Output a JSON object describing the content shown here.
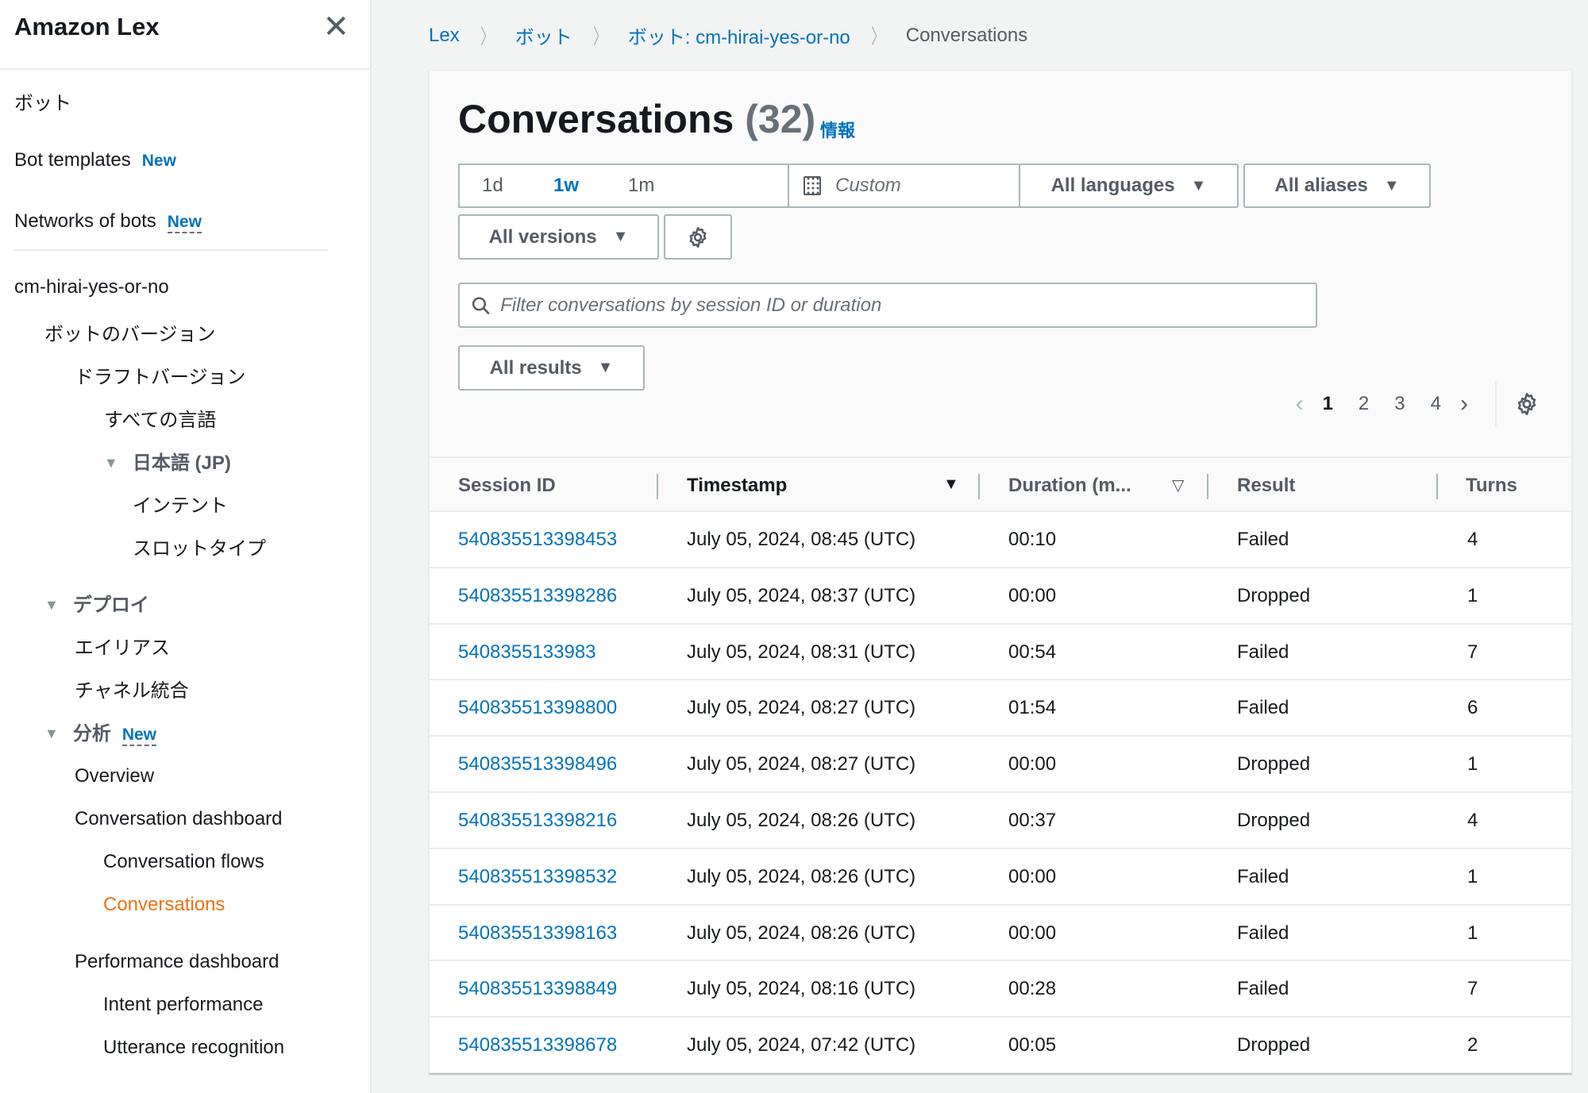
{
  "sidebar": {
    "title": "Amazon Lex",
    "close_label": "✕",
    "items": {
      "bots": "ボット",
      "bot_templates": "Bot templates",
      "bot_templates_badge": "New",
      "networks_of_bots": "Networks of bots",
      "networks_badge": "New",
      "bot_name": "cm-hirai-yes-or-no",
      "bot_versions": "ボットのバージョン",
      "draft_version": "ドラフトバージョン",
      "all_languages": "すべての言語",
      "japanese": "日本語 (JP)",
      "intents": "インテント",
      "slot_types": "スロットタイプ",
      "deploy": "デプロイ",
      "aliases": "エイリアス",
      "channel_integrations": "チャネル統合",
      "analytics": "分析",
      "analytics_badge": "New",
      "overview": "Overview",
      "conversation_dashboard": "Conversation dashboard",
      "conversation_flows": "Conversation flows",
      "conversations": "Conversations",
      "performance_dashboard": "Performance dashboard",
      "intent_performance": "Intent performance",
      "utterance_recognition": "Utterance recognition"
    }
  },
  "breadcrumb": {
    "items": [
      "Lex",
      "ボット",
      "ボット: cm-hirai-yes-or-no"
    ],
    "current": "Conversations"
  },
  "main": {
    "title": "Conversations",
    "count": "(32)",
    "info_link": "情報",
    "time_range": {
      "options": [
        "1d",
        "1w",
        "1m"
      ],
      "selected": "1w",
      "custom_placeholder": "Custom"
    },
    "filters": {
      "languages": "All languages",
      "aliases": "All aliases",
      "versions": "All versions",
      "results": "All results"
    },
    "search": {
      "placeholder": "Filter conversations by session ID or duration",
      "value": ""
    },
    "pagination": {
      "pages": [
        "1",
        "2",
        "3",
        "4"
      ],
      "current": "1"
    },
    "table": {
      "columns": [
        "Session ID",
        "Timestamp",
        "Duration (m...",
        "Result",
        "Turns"
      ],
      "sorted_column": "Timestamp",
      "rows": [
        {
          "session_id": "540835513398453",
          "timestamp": "July 05, 2024, 08:45 (UTC)",
          "duration": "00:10",
          "result": "Failed",
          "turns": "4"
        },
        {
          "session_id": "540835513398286",
          "timestamp": "July 05, 2024, 08:37 (UTC)",
          "duration": "00:00",
          "result": "Dropped",
          "turns": "1"
        },
        {
          "session_id": "5408355133983",
          "timestamp": "July 05, 2024, 08:31 (UTC)",
          "duration": "00:54",
          "result": "Failed",
          "turns": "7"
        },
        {
          "session_id": "540835513398800",
          "timestamp": "July 05, 2024, 08:27 (UTC)",
          "duration": "01:54",
          "result": "Failed",
          "turns": "6"
        },
        {
          "session_id": "540835513398496",
          "timestamp": "July 05, 2024, 08:27 (UTC)",
          "duration": "00:00",
          "result": "Dropped",
          "turns": "1"
        },
        {
          "session_id": "540835513398216",
          "timestamp": "July 05, 2024, 08:26 (UTC)",
          "duration": "00:37",
          "result": "Dropped",
          "turns": "4"
        },
        {
          "session_id": "540835513398532",
          "timestamp": "July 05, 2024, 08:26 (UTC)",
          "duration": "00:00",
          "result": "Failed",
          "turns": "1"
        },
        {
          "session_id": "540835513398163",
          "timestamp": "July 05, 2024, 08:26 (UTC)",
          "duration": "00:00",
          "result": "Failed",
          "turns": "1"
        },
        {
          "session_id": "540835513398849",
          "timestamp": "July 05, 2024, 08:16 (UTC)",
          "duration": "00:28",
          "result": "Failed",
          "turns": "7"
        },
        {
          "session_id": "540835513398678",
          "timestamp": "July 05, 2024, 07:42 (UTC)",
          "duration": "00:05",
          "result": "Dropped",
          "turns": "2"
        }
      ]
    }
  },
  "colors": {
    "link": "#0073bb",
    "active_nav": "#ec7211",
    "text": "#16191f",
    "secondary_text": "#545b64",
    "border": "#aab7b8"
  }
}
